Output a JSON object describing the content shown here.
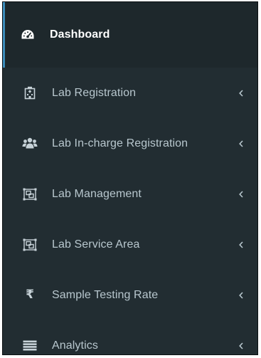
{
  "sidebar": {
    "items": [
      {
        "label": "Dashboard",
        "icon": "dashboard-gauge-icon",
        "active": true,
        "has_submenu": false
      },
      {
        "label": "Lab Registration",
        "icon": "hospital-building-icon",
        "active": false,
        "has_submenu": true
      },
      {
        "label": "Lab In-charge Registration",
        "icon": "users-group-icon",
        "active": false,
        "has_submenu": true
      },
      {
        "label": "Lab Management",
        "icon": "object-group-icon",
        "active": false,
        "has_submenu": true
      },
      {
        "label": "Lab Service Area",
        "icon": "object-group-icon",
        "active": false,
        "has_submenu": true
      },
      {
        "label": "Sample Testing Rate",
        "icon": "rupee-icon",
        "active": false,
        "has_submenu": true
      },
      {
        "label": "Analytics",
        "icon": "list-icon",
        "active": false,
        "has_submenu": true
      }
    ],
    "rupee_symbol": "₹"
  },
  "colors": {
    "sidebar_bg": "#222d32",
    "active_bg": "#1e282c",
    "active_border": "#3c8dbc",
    "text": "#b8c7ce",
    "active_text": "#ffffff"
  }
}
